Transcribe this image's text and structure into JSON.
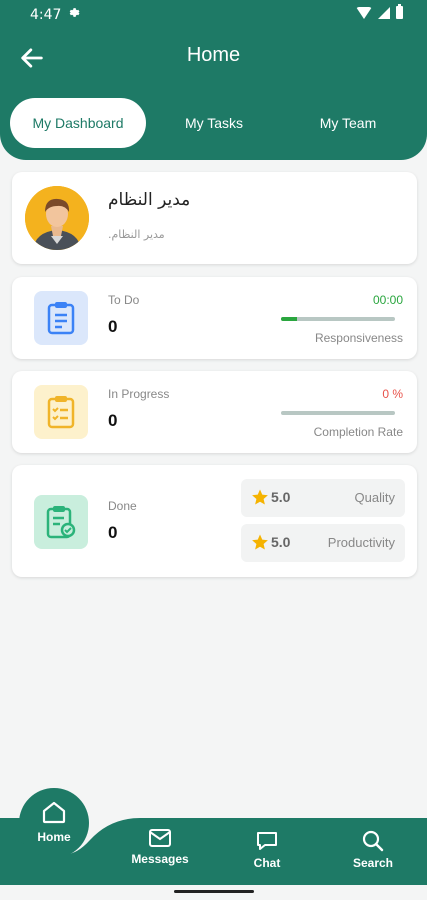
{
  "status_bar": {
    "time": "4:47"
  },
  "header": {
    "title": "Home"
  },
  "tabs": [
    {
      "label": "My Dashboard",
      "active": true
    },
    {
      "label": "My Tasks",
      "active": false
    },
    {
      "label": "My Team",
      "active": false
    }
  ],
  "profile": {
    "name": "مدير النظام",
    "subtitle": "مدير النظام."
  },
  "stats": {
    "todo": {
      "label": "To Do",
      "value": "0",
      "metric_value": "00:00",
      "metric_label": "Responsiveness",
      "metric_fill": 0.14,
      "icon": "clipboard-icon",
      "color": "#3b82f6"
    },
    "in_progress": {
      "label": "In Progress",
      "value": "0",
      "metric_value": "0 %",
      "metric_label": "Completion Rate",
      "metric_fill": 0,
      "icon": "clipboard-list-icon",
      "color": "#f0b429"
    },
    "done": {
      "label": "Done",
      "value": "0",
      "icon": "clipboard-check-icon",
      "color": "#2bb37a"
    }
  },
  "ratings": [
    {
      "value": "5.0",
      "label": "Quality",
      "icon": "star-icon"
    },
    {
      "value": "5.0",
      "label": "Productivity",
      "icon": "star-icon"
    }
  ],
  "nav": {
    "home": "Home",
    "messages": "Messages",
    "chat": "Chat",
    "search": "Search"
  },
  "colors": {
    "primary": "#1e7a66",
    "green": "#2aa63f",
    "red": "#e8524a",
    "star": "#f5b301"
  }
}
